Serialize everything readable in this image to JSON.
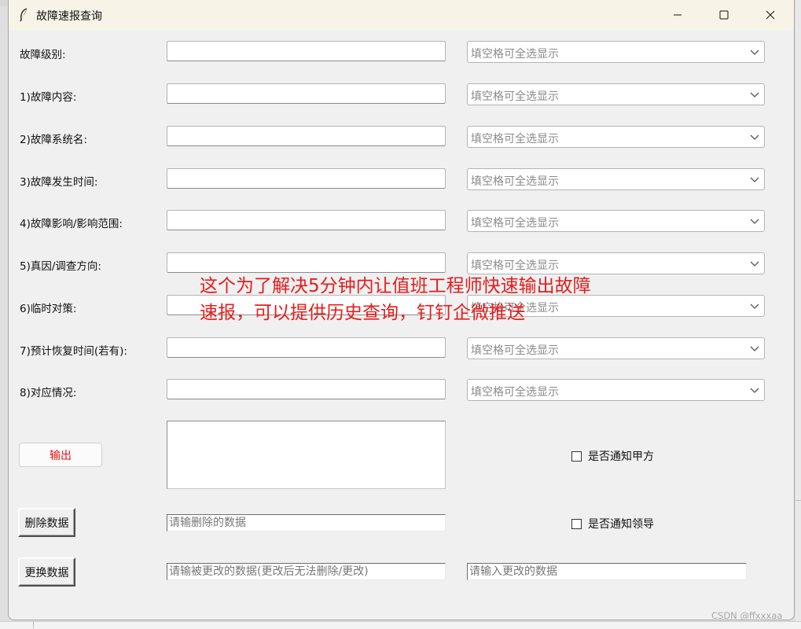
{
  "window": {
    "title": "故障速报查询",
    "controls": {
      "minimize": "minimize",
      "maximize": "maximize",
      "close": "close"
    }
  },
  "form": {
    "combo_placeholder": "填空格可全选显示",
    "fields": [
      {
        "label": "故障级别:",
        "value": "",
        "combo": "填空格可全选显示"
      },
      {
        "label": "1)故障内容:",
        "value": "",
        "combo": "填空格可全选显示"
      },
      {
        "label": "2)故障系统名:",
        "value": "",
        "combo": "填空格可全选显示"
      },
      {
        "label": "3)故障发生时间:",
        "value": "",
        "combo": "填空格可全选显示"
      },
      {
        "label": "4)故障影响/影响范围:",
        "value": "",
        "combo": "填空格可全选显示"
      },
      {
        "label": "5)真因/调查方向:",
        "value": "",
        "combo": "填空格可全选显示"
      },
      {
        "label": "6)临时对策:",
        "value": "",
        "combo": "填空格可全选显示"
      },
      {
        "label": "7)预计恢复时间(若有):",
        "value": "",
        "combo": "填空格可全选显示"
      },
      {
        "label": "8)对应情况:",
        "value": "",
        "combo": "填空格可全选显示"
      }
    ]
  },
  "actions": {
    "output_label": "输出",
    "output_text": "",
    "notify_client_label": "是否通知甲方",
    "notify_client_checked": false,
    "notify_leader_label": "是否通知领导",
    "notify_leader_checked": false,
    "delete_label": "删除数据",
    "delete_placeholder": "请输删除的数据",
    "replace_label": "更换数据",
    "replace_old_placeholder": "请输被更改的数据(更改后无法删除/更改)",
    "replace_new_placeholder": "请输入更改的数据"
  },
  "annotation": {
    "line1": "这个为了解决5分钟内让值班工程师快速输出故障",
    "line2": "速报，可以提供历史查询，钉钉企微推送"
  },
  "watermark": "CSDN @ffxxxaa",
  "colors": {
    "annotation": "#e51c1c",
    "output_button_text": "#ee1111",
    "titlebar": "#f7f3e6",
    "window_bg": "#f0f0f0"
  }
}
